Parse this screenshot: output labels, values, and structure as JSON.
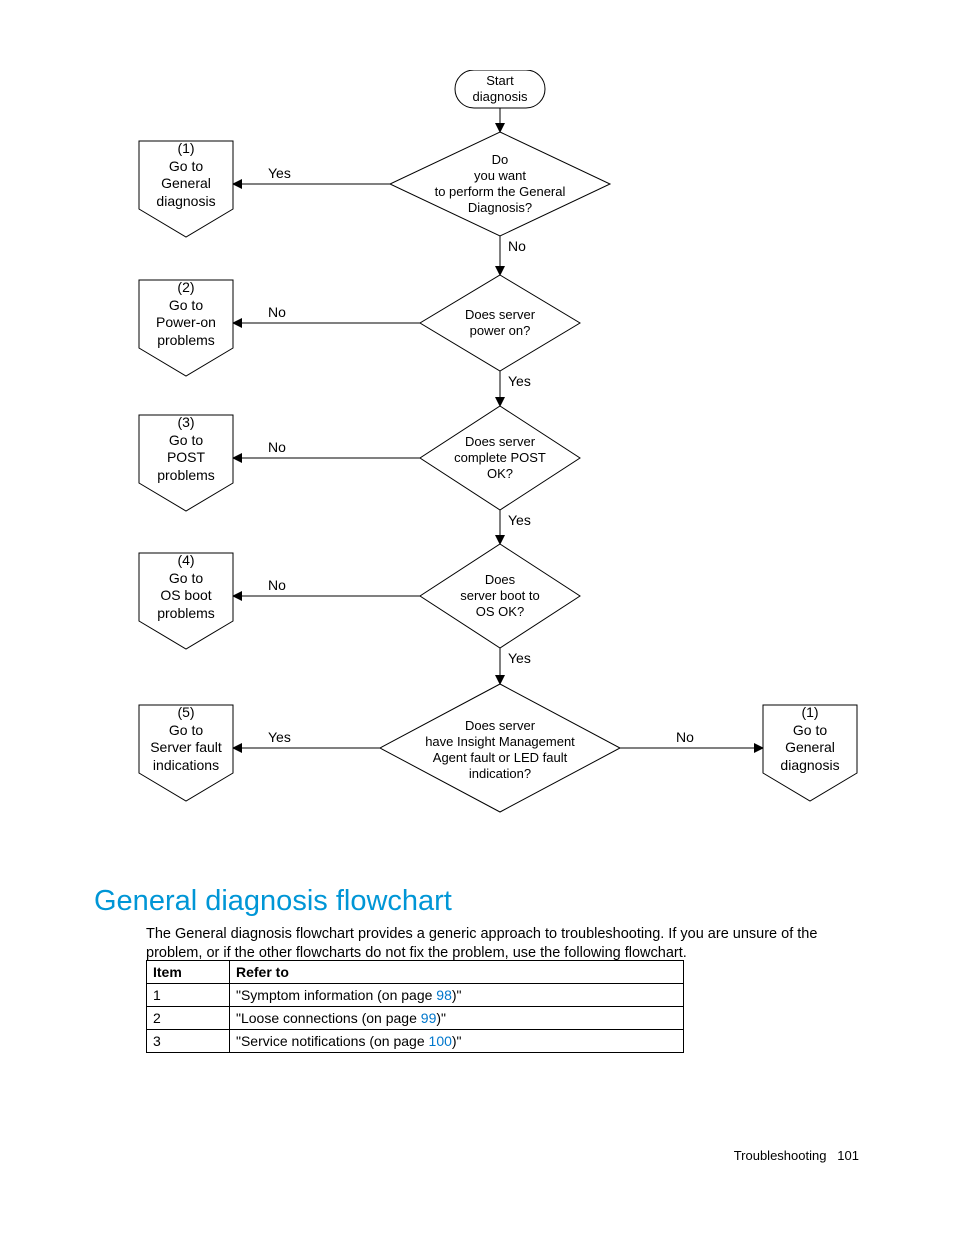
{
  "flow": {
    "start": "Start\ndiagnosis",
    "d1": "Do\nyou want\nto perform the General\nDiagnosis?",
    "d2": "Does server\npower on?",
    "d3": "Does server\ncomplete POST\nOK?",
    "d4": "Does\nserver boot to\nOS OK?",
    "d5": "Does server\nhave Insight Management\nAgent fault or LED fault\nindication?",
    "off1": "(1)\nGo to\nGeneral\ndiagnosis",
    "off2": "(2)\nGo to\nPower-on\nproblems",
    "off3": "(3)\nGo to\nPOST\nproblems",
    "off4": "(4)\nGo to\nOS boot\nproblems",
    "off5": "(5)\nGo to\nServer fault\nindications",
    "off1r": "(1)\nGo to\nGeneral\ndiagnosis",
    "labels": {
      "yes": "Yes",
      "no": "No"
    }
  },
  "heading": "General diagnosis flowchart",
  "paragraph": "The General diagnosis flowchart provides a generic approach to troubleshooting. If you are unsure of the problem, or if the other flowcharts do not fix the problem, use the following flowchart.",
  "table": {
    "headers": {
      "item": "Item",
      "refer": "Refer to"
    },
    "rows": [
      {
        "item": "1",
        "text_before": "\"Symptom information (on page ",
        "link": "98",
        "text_after": ")\""
      },
      {
        "item": "2",
        "text_before": "\"Loose connections (on page ",
        "link": "99",
        "text_after": ")\""
      },
      {
        "item": "3",
        "text_before": "\"Service notifications (on page ",
        "link": "100",
        "text_after": ")\""
      }
    ]
  },
  "footer": {
    "section": "Troubleshooting",
    "page": "101"
  },
  "chart_data": {
    "type": "flowchart",
    "nodes": [
      {
        "id": "start",
        "shape": "terminator",
        "label": "Start diagnosis"
      },
      {
        "id": "d1",
        "shape": "decision",
        "label": "Do you want to perform the General Diagnosis?"
      },
      {
        "id": "d2",
        "shape": "decision",
        "label": "Does server power on?"
      },
      {
        "id": "d3",
        "shape": "decision",
        "label": "Does server complete POST OK?"
      },
      {
        "id": "d4",
        "shape": "decision",
        "label": "Does server boot to OS OK?"
      },
      {
        "id": "d5",
        "shape": "decision",
        "label": "Does server have Insight Management Agent fault or LED fault indication?"
      },
      {
        "id": "off1",
        "shape": "offpage",
        "label": "(1) Go to General diagnosis"
      },
      {
        "id": "off2",
        "shape": "offpage",
        "label": "(2) Go to Power-on problems"
      },
      {
        "id": "off3",
        "shape": "offpage",
        "label": "(3) Go to POST problems"
      },
      {
        "id": "off4",
        "shape": "offpage",
        "label": "(4) Go to OS boot problems"
      },
      {
        "id": "off5",
        "shape": "offpage",
        "label": "(5) Go to Server fault indications"
      },
      {
        "id": "off1r",
        "shape": "offpage",
        "label": "(1) Go to General diagnosis"
      }
    ],
    "edges": [
      {
        "from": "start",
        "to": "d1",
        "label": ""
      },
      {
        "from": "d1",
        "to": "off1",
        "label": "Yes"
      },
      {
        "from": "d1",
        "to": "d2",
        "label": "No"
      },
      {
        "from": "d2",
        "to": "off2",
        "label": "No"
      },
      {
        "from": "d2",
        "to": "d3",
        "label": "Yes"
      },
      {
        "from": "d3",
        "to": "off3",
        "label": "No"
      },
      {
        "from": "d3",
        "to": "d4",
        "label": "Yes"
      },
      {
        "from": "d4",
        "to": "off4",
        "label": "No"
      },
      {
        "from": "d4",
        "to": "d5",
        "label": "Yes"
      },
      {
        "from": "d5",
        "to": "off5",
        "label": "Yes"
      },
      {
        "from": "d5",
        "to": "off1r",
        "label": "No"
      }
    ]
  }
}
